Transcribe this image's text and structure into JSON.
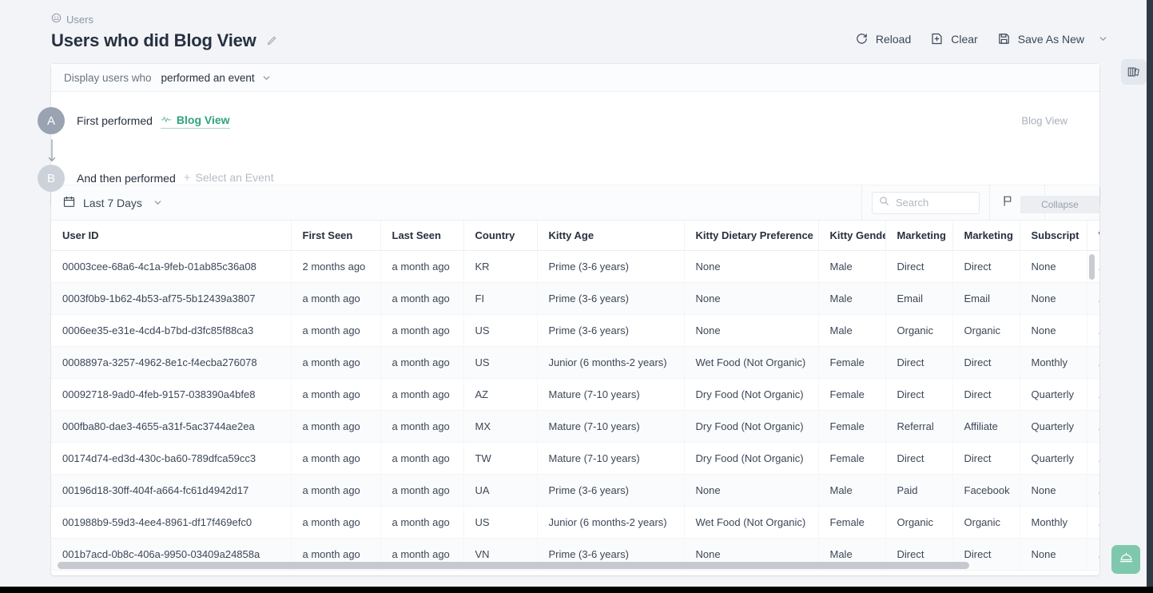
{
  "breadcrumb": {
    "icon": "users-circle-icon",
    "label": "Users"
  },
  "header": {
    "title": "Users who did Blog View",
    "edit_icon": "pencil-icon",
    "actions": [
      {
        "id": "reload",
        "label": "Reload",
        "icon": "refresh-icon"
      },
      {
        "id": "clear",
        "label": "Clear",
        "icon": "file-plus-icon"
      },
      {
        "id": "save-as-new",
        "label": "Save As New",
        "icon": "floppy-disk-icon",
        "caret": "chevron-down-icon"
      }
    ]
  },
  "right_rail": {
    "grid_icon": "table-columns-icon"
  },
  "query": {
    "display_label": "Display users who",
    "display_value": "performed an event",
    "display_caret": "chevron-down-icon",
    "steps": [
      {
        "badge": "A",
        "text": "First performed",
        "event_icon": "activity-pulse-icon",
        "event": "Blog View",
        "right_label": "Blog View"
      },
      {
        "badge": "B",
        "text": "And then performed",
        "plus": "+",
        "event": "Select an Event",
        "right_label": ""
      }
    ],
    "collapse_label": "Collapse"
  },
  "table_toolbar": {
    "calendar_icon": "calendar-icon",
    "date_range": "Last 7 Days",
    "date_caret": "chevron-down-icon",
    "search_icon": "search-icon",
    "search_placeholder": "Search",
    "search_value": "",
    "flag_icon": "flag-icon",
    "flag_caret": "chevron-down-icon",
    "download_icon": "download-icon",
    "download_caret": "chevron-down-icon"
  },
  "table": {
    "columns": [
      "User ID",
      "First Seen",
      "Last Seen",
      "Country",
      "Kitty Age",
      "Kitty Dietary Preference",
      "Kitty Gende",
      "Marketing",
      "Marketing",
      "Subscript",
      "'"
    ],
    "rows": [
      [
        "00003cee-68a6-4c1a-9feb-01ab85c36a08",
        "2 months ago",
        "a month ago",
        "KR",
        "Prime (3-6 years)",
        "None",
        "Male",
        "Direct",
        "Direct",
        "None",
        "."
      ],
      [
        "0003f0b9-1b62-4b53-af75-5b12439a3807",
        "a month ago",
        "a month ago",
        "FI",
        "Prime (3-6 years)",
        "None",
        "Male",
        "Email",
        "Email",
        "None",
        "."
      ],
      [
        "0006ee35-e31e-4cd4-b7bd-d3fc85f88ca3",
        "a month ago",
        "a month ago",
        "US",
        "Prime (3-6 years)",
        "None",
        "Male",
        "Organic",
        "Organic",
        "None",
        "."
      ],
      [
        "0008897a-3257-4962-8e1c-f4ecba276078",
        "a month ago",
        "a month ago",
        "US",
        "Junior (6 months-2 years)",
        "Wet Food (Not Organic)",
        "Female",
        "Direct",
        "Direct",
        "Monthly",
        "."
      ],
      [
        "00092718-9ad0-4feb-9157-038390a4bfe8",
        "a month ago",
        "a month ago",
        "AZ",
        "Mature (7-10 years)",
        "Dry Food (Not Organic)",
        "Female",
        "Direct",
        "Direct",
        "Quarterly",
        "."
      ],
      [
        "000fba80-dae3-4655-a31f-5ac3744ae2ea",
        "a month ago",
        "a month ago",
        "MX",
        "Mature (7-10 years)",
        "Dry Food (Not Organic)",
        "Female",
        "Referral",
        "Affiliate",
        "Quarterly",
        "."
      ],
      [
        "00174d74-ed3d-430c-ba60-789dfca59cc3",
        "a month ago",
        "a month ago",
        "TW",
        "Mature (7-10 years)",
        "Dry Food (Not Organic)",
        "Female",
        "Direct",
        "Direct",
        "Quarterly",
        "."
      ],
      [
        "00196d18-30ff-404f-a664-fc61d4942d17",
        "a month ago",
        "a month ago",
        "UA",
        "Prime (3-6 years)",
        "None",
        "Male",
        "Paid",
        "Facebook",
        "None",
        "."
      ],
      [
        "001988b9-59d3-4ee4-8961-df17f469efc0",
        "a month ago",
        "a month ago",
        "US",
        "Junior (6 months-2 years)",
        "Wet Food (Not Organic)",
        "Female",
        "Organic",
        "Organic",
        "Monthly",
        "."
      ],
      [
        "001b7acd-0b8c-406a-9950-03409a24858a",
        "a month ago",
        "a month ago",
        "VN",
        "Prime (3-6 years)",
        "None",
        "Male",
        "Direct",
        "Direct",
        "None",
        "."
      ]
    ]
  },
  "fab": {
    "icon": "service-bell-icon"
  },
  "colors": {
    "accent": "#2fa37c",
    "fab": "#7fc8ad",
    "badge_a": "#9aa3b2",
    "badge_b": "#cdd2da"
  }
}
